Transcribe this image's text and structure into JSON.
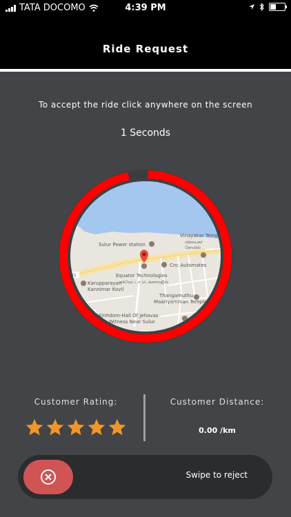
{
  "status_bar": {
    "carrier": "TATA DOCOMO",
    "time": "4:39 PM"
  },
  "header": {
    "title": "Ride Request"
  },
  "instruction": "To accept the ride click anywhere on the screen",
  "countdown": "1 Seconds",
  "timer_progress": 0.97,
  "map": {
    "labels": {
      "sulur_power": "Sulur Power station",
      "vinayakar": "Vinayakar Temple",
      "vinayakar_ta1": "விநாயகர்",
      "vinayakar_ta2": "கோவில்",
      "cnc": "Cnc Automates",
      "equator1": "Equator Technologies",
      "equator2": "ஈக்வேட்டர் டெக்னாலஜீஸ்",
      "karuppa1": "Karupparayan",
      "karuppa2": "Kannimar Kovil",
      "thanga1": "Thangamuthu",
      "thanga2": "Maariyamman Temple",
      "kinhdom1": "Kinhdom-Hall Of Jehovas",
      "kinhdom2": "Witness Near Sulur",
      "road": "81",
      "corner": "Su"
    }
  },
  "stats": {
    "rating_label": "Customer Rating:",
    "rating": 5,
    "distance_label": "Customer Distance:",
    "distance_value": "0.00 /km"
  },
  "swipe": {
    "text": "Swipe to reject"
  },
  "colors": {
    "background": "#424447",
    "ring": "#ff0000",
    "star": "#f0962a",
    "reject": "#d05454"
  }
}
